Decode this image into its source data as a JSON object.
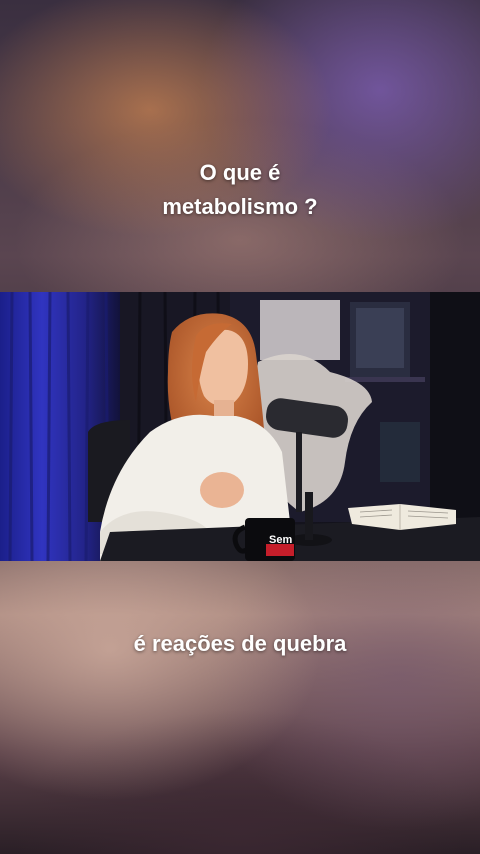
{
  "captions": {
    "top_line1": "O que é",
    "top_line2": "metabolismo ?",
    "bottom": "é reações de quebra"
  },
  "video_frame": {
    "mug_text": "Sem"
  },
  "colors": {
    "caption_text": "#ffffff",
    "curtain_blue": "#2c2fb0",
    "hair": "#c7703c",
    "blouse": "#f2efe9"
  }
}
